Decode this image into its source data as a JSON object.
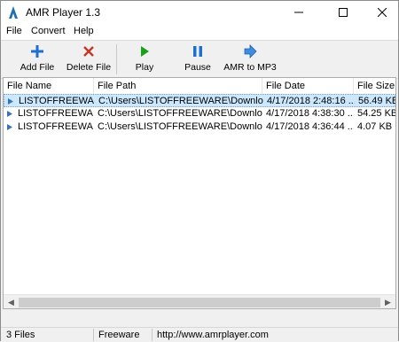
{
  "window": {
    "title": "AMR Player 1.3"
  },
  "menu": [
    "File",
    "Convert",
    "Help"
  ],
  "toolbar": {
    "add_file": "Add File",
    "delete_file": "Delete File",
    "play": "Play",
    "pause": "Pause",
    "amr_to_mp3": "AMR to MP3"
  },
  "list": {
    "columns": [
      "File Name",
      "File Path",
      "File Date",
      "File Size"
    ],
    "rows": [
      {
        "name": "LISTOFFREEWA...",
        "path": "C:\\Users\\LISTOFFREEWARE\\Downloads...",
        "date": "4/17/2018 2:48:16 ...",
        "size": "56.49 KB"
      },
      {
        "name": "LISTOFFREEWA...",
        "path": "C:\\Users\\LISTOFFREEWARE\\Downloads...",
        "date": "4/17/2018 4:38:30 ...",
        "size": "54.25 KB"
      },
      {
        "name": "LISTOFFREEWA...",
        "path": "C:\\Users\\LISTOFFREEWARE\\Downloads...",
        "date": "4/17/2018 4:36:44 ...",
        "size": "4.07 KB"
      }
    ]
  },
  "status": {
    "files": "3 Files",
    "license": "Freeware",
    "url": "http://www.amrplayer.com"
  },
  "colors": {
    "accent": "#0078d7",
    "play": "#1aa11a",
    "delete": "#c0392b",
    "selection": "#cce8ff"
  }
}
